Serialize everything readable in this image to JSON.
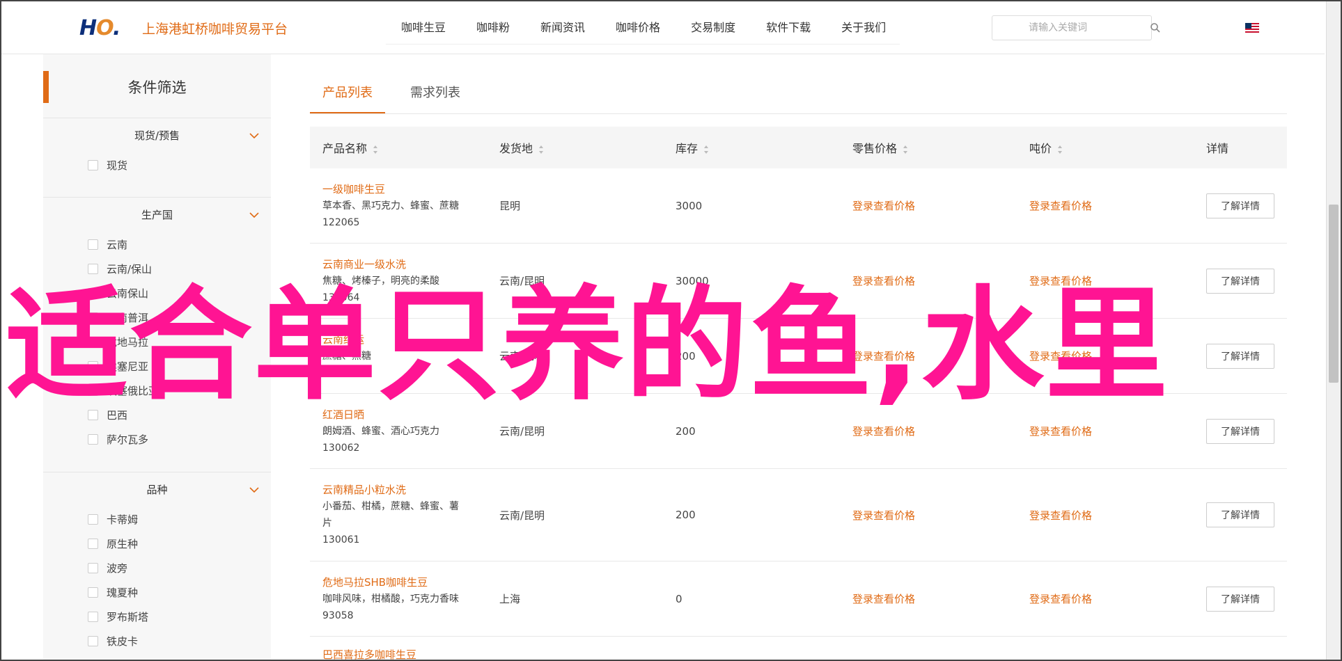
{
  "header": {
    "logo_text": "HO",
    "site_name": "上海港虹桥咖啡贸易平台",
    "nav": [
      "咖啡生豆",
      "咖啡粉",
      "新闻资讯",
      "咖啡价格",
      "交易制度",
      "软件下载",
      "关于我们"
    ],
    "search_placeholder": "请输入关键词",
    "flag_icon": "us-flag-icon"
  },
  "sidebar": {
    "title": "条件筛选",
    "groups": [
      {
        "title": "现货/预售",
        "options": [
          "现货"
        ]
      },
      {
        "title": "生产国",
        "options": [
          "云南",
          "云南/保山",
          "云南保山",
          "云南普洱",
          "危地马拉",
          "埃塞尼亚",
          "埃塞俄比亚",
          "巴西",
          "萨尔瓦多"
        ]
      },
      {
        "title": "品种",
        "options": [
          "卡蒂姆",
          "原生种",
          "波旁",
          "瑰夏种",
          "罗布斯塔",
          "铁皮卡"
        ]
      }
    ]
  },
  "main": {
    "tabs": [
      "产品列表",
      "需求列表"
    ],
    "columns": [
      "产品名称",
      "发货地",
      "库存",
      "零售价格",
      "吨价",
      "详情"
    ],
    "rows": [
      {
        "name": "一级咖啡生豆",
        "desc": "草本香、黑巧克力、蜂蜜、蔗糖",
        "code": "122065",
        "origin": "昆明",
        "stock": "3000",
        "retail": "登录查看价格",
        "ton": "登录查看价格",
        "detail": "了解详情"
      },
      {
        "name": "云南商业一级水洗",
        "desc": "焦糖、烤榛子，明亮的柔酸",
        "code": "130064",
        "origin": "云南/昆明",
        "stock": "30000",
        "retail": "登录查看价格",
        "ton": "登录查看价格",
        "detail": "了解详情"
      },
      {
        "name": "云南红运",
        "desc": "蔗糖、黑糖",
        "code": "130063",
        "origin": "云南/昆明",
        "stock": "200",
        "retail": "登录查看价格",
        "ton": "登录查看价格",
        "detail": "了解详情"
      },
      {
        "name": "红酒日晒",
        "desc": "朗姆酒、蜂蜜、酒心巧克力",
        "code": "130062",
        "origin": "云南/昆明",
        "stock": "200",
        "retail": "登录查看价格",
        "ton": "登录查看价格",
        "detail": "了解详情"
      },
      {
        "name": "云南精品小粒水洗",
        "desc": "小番茄、柑橘，蔗糖、蜂蜜、薯片",
        "code": "130061",
        "origin": "云南/昆明",
        "stock": "200",
        "retail": "登录查看价格",
        "ton": "登录查看价格",
        "detail": "了解详情"
      },
      {
        "name": "危地马拉SHB咖啡生豆",
        "desc": "咖啡风味，柑橘酸，巧克力香味",
        "code": "93058",
        "origin": "上海",
        "stock": "0",
        "retail": "登录查看价格",
        "ton": "登录查看价格",
        "detail": "了解详情"
      },
      {
        "name": "巴西喜拉多咖啡生豆",
        "desc": "",
        "code": "",
        "origin": "",
        "stock": "",
        "retail": "",
        "ton": "",
        "detail": ""
      }
    ]
  },
  "overlay_text": "适合单只养的鱼,水里",
  "colors": {
    "accent": "#e06b16",
    "overlay": "#ff1493",
    "logo": "#0d2f7a"
  }
}
